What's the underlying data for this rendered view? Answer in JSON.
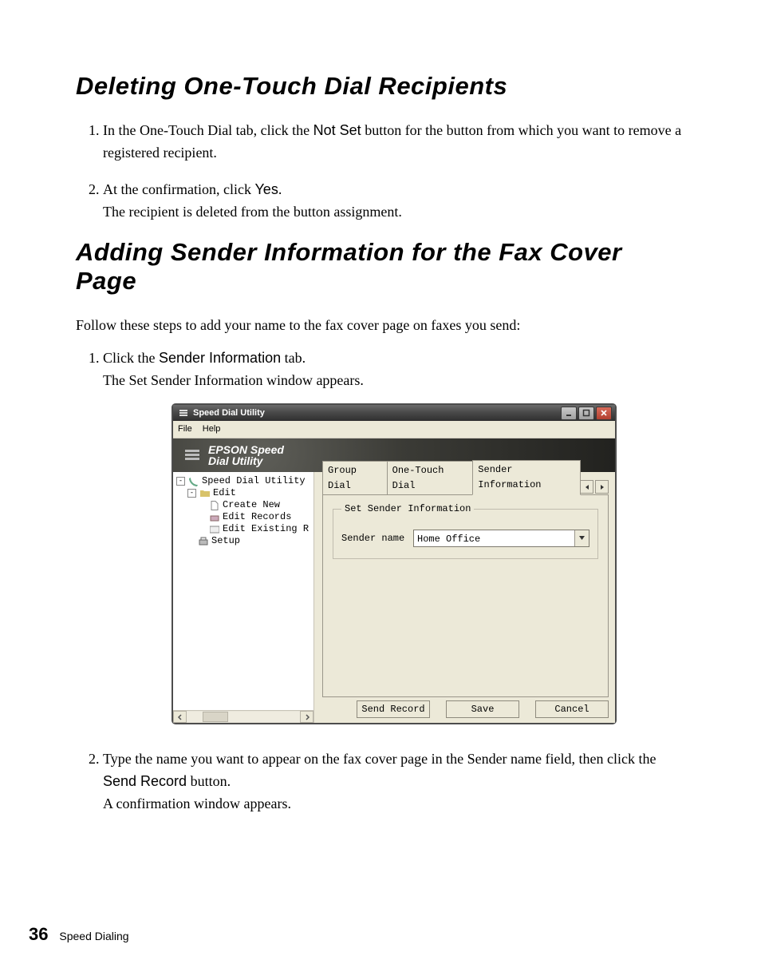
{
  "section1": {
    "heading": "Deleting One-Touch Dial Recipients",
    "step1_a": "In the One-Touch Dial tab, click the ",
    "step1_bold": "Not Set",
    "step1_b": " button for the button from which you want to remove a registered recipient.",
    "step2_a": "At the confirmation, click ",
    "step2_bold": "Yes",
    "step2_b": ".",
    "step2_after": "The recipient is deleted from the button assignment."
  },
  "section2": {
    "heading": "Adding Sender Information for the Fax Cover Page",
    "intro": "Follow these steps to add your name to the fax cover page on faxes you send:",
    "step1_a": "Click the ",
    "step1_bold": "Sender Information",
    "step1_b": " tab.",
    "step1_after": "The Set Sender Information window appears.",
    "step2_a": "Type the name you want to appear on the fax cover page in the Sender name field, then click the ",
    "step2_bold": "Send Record",
    "step2_b": " button.",
    "step2_after": "A confirmation window appears."
  },
  "window": {
    "title": "Speed Dial Utility",
    "menu": {
      "file": "File",
      "help": "Help"
    },
    "banner": {
      "line1": "EPSON Speed",
      "line2": "Dial Utility"
    },
    "tree": {
      "root": "Speed Dial Utility",
      "edit": "Edit",
      "create": "Create New",
      "records": "Edit Records",
      "existing": "Edit Existing R",
      "setup": "Setup"
    },
    "tabs": {
      "group": "Group Dial",
      "onetouch": "One-Touch Dial",
      "sender": "Sender Information"
    },
    "group_legend": "Set Sender Information",
    "sender_label": "Sender name",
    "sender_value": "Home Office",
    "buttons": {
      "send": "Send Record",
      "save": "Save",
      "cancel": "Cancel"
    }
  },
  "footer": {
    "page": "36",
    "chapter": "Speed Dialing"
  }
}
